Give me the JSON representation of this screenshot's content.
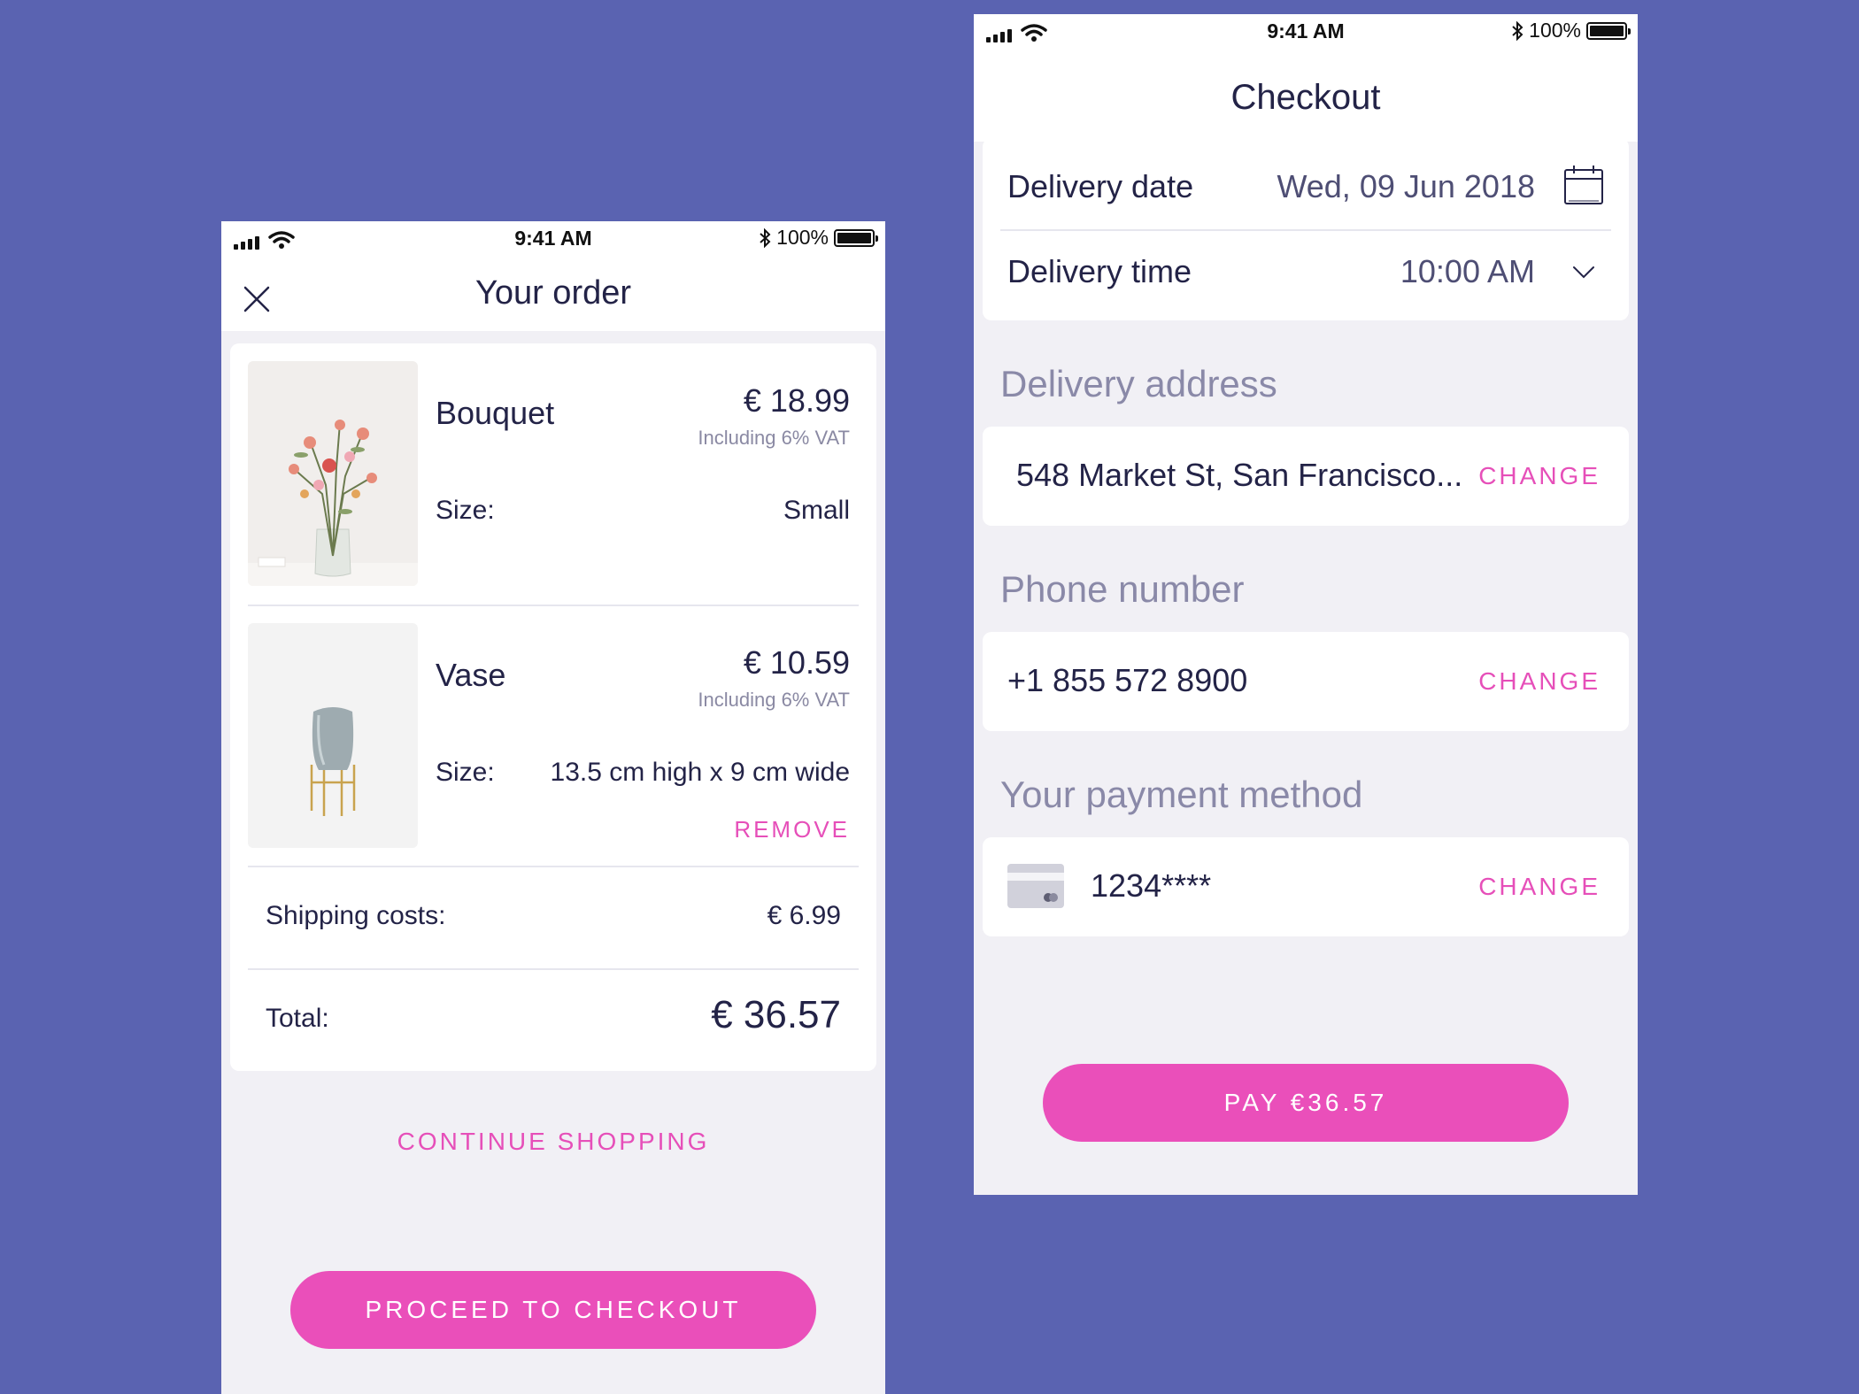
{
  "status_bar": {
    "time": "9:41 AM",
    "battery": "100%"
  },
  "order_screen": {
    "title": "Your order",
    "items": [
      {
        "name": "Bouquet",
        "price": "€ 18.99",
        "vat": "Including 6% VAT",
        "size_label": "Size:",
        "size_value": "Small"
      },
      {
        "name": "Vase",
        "price": "€ 10.59",
        "vat": "Including 6% VAT",
        "size_label": "Size:",
        "size_value": "13.5 cm high x 9 cm wide",
        "remove_label": "REMOVE"
      }
    ],
    "shipping_label": "Shipping costs:",
    "shipping_value": "€ 6.99",
    "total_label": "Total:",
    "total_value": "€ 36.57",
    "continue_label": "CONTINUE SHOPPING",
    "checkout_label": "PROCEED TO CHECKOUT"
  },
  "checkout_screen": {
    "title": "Checkout",
    "delivery_date_label": "Delivery date",
    "delivery_date_value": "Wed, 09 Jun 2018",
    "delivery_time_label": "Delivery time",
    "delivery_time_value": "10:00 AM",
    "address_heading": "Delivery address",
    "address_value": "548 Market St, San Francisco...",
    "phone_heading": "Phone number",
    "phone_value": "+1 855 572 8900",
    "payment_heading": "Your payment method",
    "payment_value": "1234****",
    "change_label": "CHANGE",
    "pay_label": "PAY €36.57"
  },
  "colors": {
    "background": "#5A63B1",
    "accent": "#EA4FBA",
    "text": "#232347",
    "muted": "#8A89A3",
    "screen_bg": "#F1F0F5"
  },
  "icons": [
    "signal-icon",
    "wifi-icon",
    "bluetooth-icon",
    "battery-icon",
    "close-icon",
    "calendar-icon",
    "chevron-down-icon",
    "credit-card-icon"
  ]
}
